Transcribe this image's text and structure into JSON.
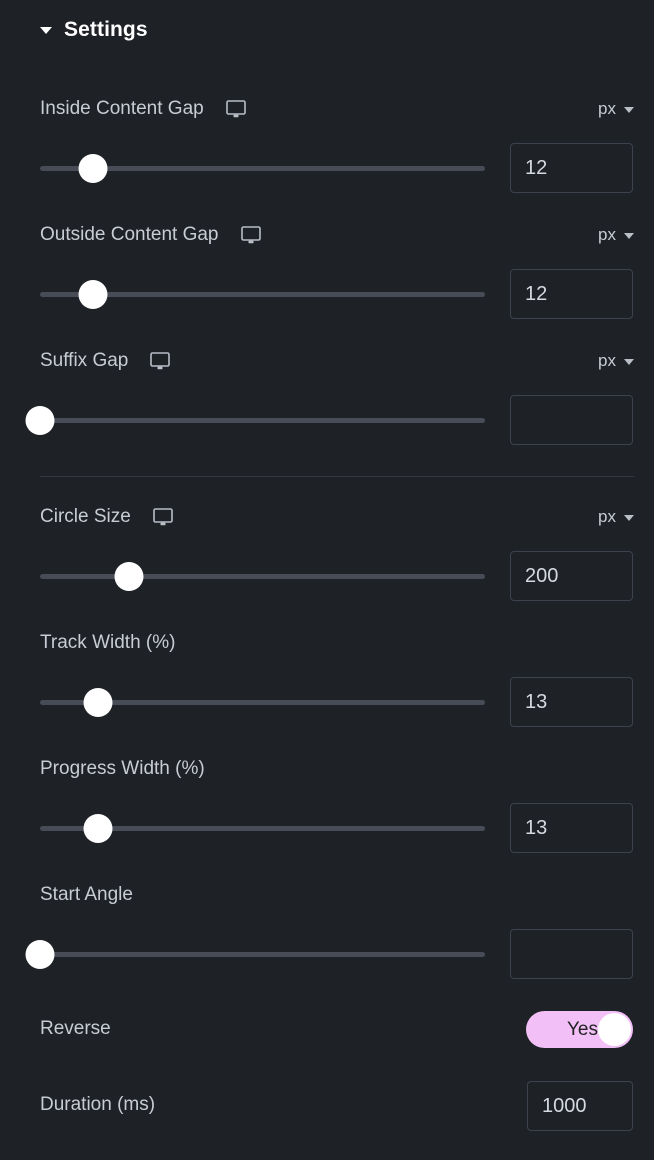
{
  "section": {
    "title": "Settings",
    "caret_icon": "chevron-down-icon",
    "expanded": true
  },
  "theme": {
    "background": "#1e2125",
    "label_color": "#c8ccd4",
    "track_color": "#474c57",
    "handle_color": "#ffffff",
    "input_border": "#3d434d",
    "accent": "#f2c0f7",
    "divider": "#343941"
  },
  "controls": [
    {
      "id": "inside-content-gap",
      "label": "Inside Content Gap",
      "device_icon": "desktop-monitor-icon",
      "unit": "px",
      "unit_caret_icon": "chevron-down-icon",
      "value": "12",
      "placeholder": "",
      "slider_percent": 12,
      "type": "slider-unit"
    },
    {
      "id": "outside-content-gap",
      "label": "Outside Content Gap",
      "device_icon": "desktop-monitor-icon",
      "unit": "px",
      "unit_caret_icon": "chevron-down-icon",
      "value": "12",
      "placeholder": "",
      "slider_percent": 12,
      "type": "slider-unit"
    },
    {
      "id": "suffix-gap",
      "label": "Suffix Gap",
      "device_icon": "desktop-monitor-icon",
      "unit": "px",
      "unit_caret_icon": "chevron-down-icon",
      "value": "",
      "placeholder": "",
      "slider_percent": 0,
      "type": "slider-unit"
    },
    {
      "id": "circle-size",
      "label": "Circle Size",
      "device_icon": "desktop-monitor-icon",
      "unit": "px",
      "unit_caret_icon": "chevron-down-icon",
      "value": "200",
      "placeholder": "",
      "slider_percent": 20,
      "type": "slider-unit"
    },
    {
      "id": "track-width",
      "label": "Track Width (%)",
      "device_icon": "",
      "unit": "",
      "unit_caret_icon": "",
      "value": "13",
      "placeholder": "",
      "slider_percent": 13,
      "type": "slider"
    },
    {
      "id": "progress-width",
      "label": "Progress Width (%)",
      "device_icon": "",
      "unit": "",
      "unit_caret_icon": "",
      "value": "13",
      "placeholder": "",
      "slider_percent": 13,
      "type": "slider"
    },
    {
      "id": "start-angle",
      "label": "Start Angle",
      "device_icon": "",
      "unit": "",
      "unit_caret_icon": "",
      "value": "",
      "placeholder": "",
      "slider_percent": 0,
      "type": "slider"
    }
  ],
  "reverse": {
    "label": "Reverse",
    "toggle_value": "Yes",
    "toggle_on": true
  },
  "duration": {
    "label": "Duration (ms)",
    "value": "1000",
    "placeholder": ""
  }
}
